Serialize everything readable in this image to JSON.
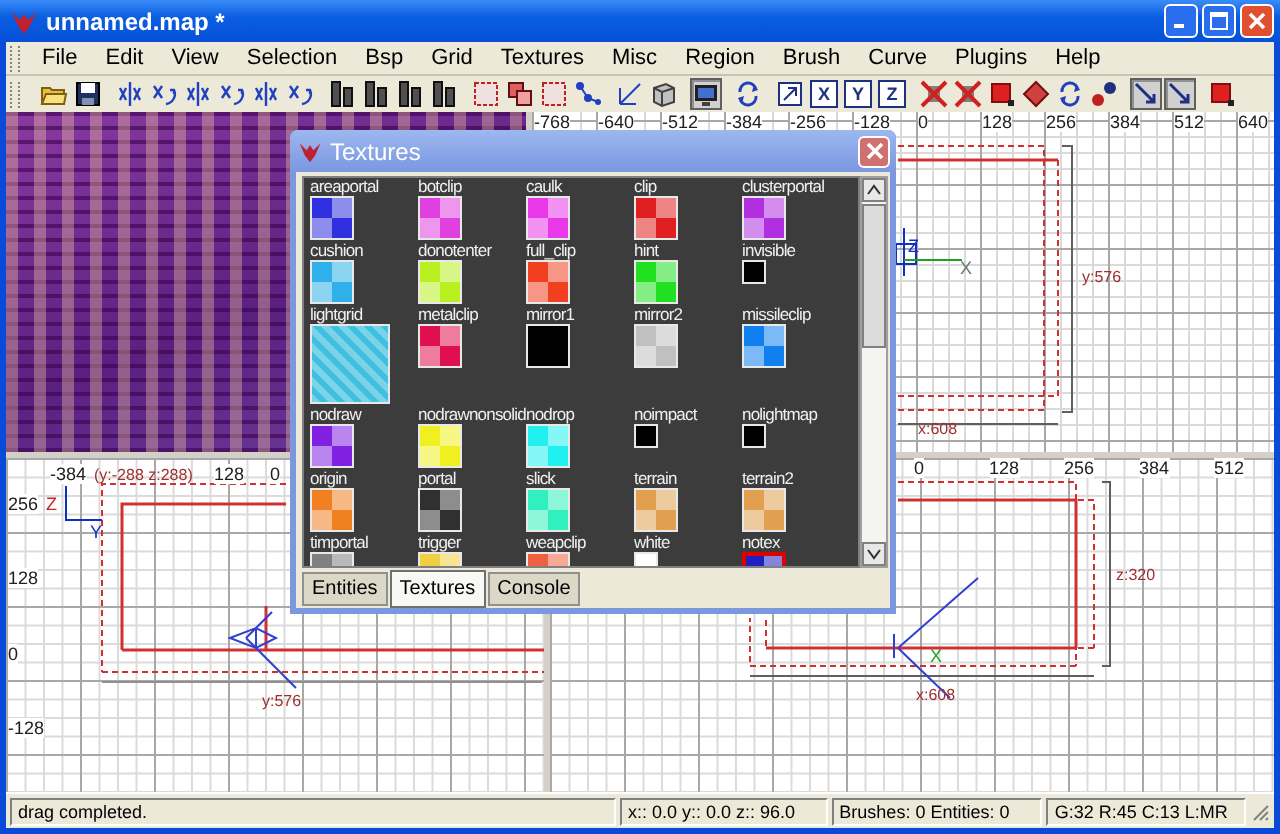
{
  "window": {
    "title": "unnamed.map *"
  },
  "menu": [
    "File",
    "Edit",
    "View",
    "Selection",
    "Bsp",
    "Grid",
    "Textures",
    "Misc",
    "Region",
    "Brush",
    "Curve",
    "Plugins",
    "Help"
  ],
  "toolbar": [
    [
      {
        "kind": "folder",
        "pressed": false
      },
      {
        "kind": "disk",
        "pressed": false
      }
    ],
    [
      {
        "kind": "flip",
        "pressed": false
      },
      {
        "kind": "rotate",
        "pressed": false
      },
      {
        "kind": "flip",
        "pressed": false
      },
      {
        "kind": "rotate",
        "pressed": false
      },
      {
        "kind": "flip",
        "pressed": false
      },
      {
        "kind": "rotate",
        "pressed": false
      }
    ],
    [
      {
        "kind": "brush",
        "pressed": false
      },
      {
        "kind": "brush",
        "pressed": false
      },
      {
        "kind": "brush",
        "pressed": false
      },
      {
        "kind": "brush",
        "pressed": false
      }
    ],
    [
      {
        "kind": "marquee",
        "pressed": false
      },
      {
        "kind": "copy",
        "pressed": false
      },
      {
        "kind": "marquee",
        "pressed": false
      },
      {
        "kind": "nodes",
        "pressed": false
      }
    ],
    [
      {
        "kind": "axes",
        "pressed": false
      },
      {
        "kind": "cube",
        "pressed": false
      }
    ],
    [
      {
        "kind": "monitor",
        "pressed": true
      }
    ],
    [
      {
        "kind": "cycle",
        "pressed": false
      }
    ],
    [
      {
        "kind": "arrow-box",
        "pressed": false
      },
      {
        "kind": "letter",
        "label": "X",
        "pressed": false
      },
      {
        "kind": "letter",
        "label": "Y",
        "pressed": false
      },
      {
        "kind": "letter",
        "label": "Z",
        "pressed": false
      }
    ],
    [
      {
        "kind": "red-cross",
        "pressed": false
      },
      {
        "kind": "red-cross",
        "pressed": false
      },
      {
        "kind": "red-square",
        "pressed": false
      },
      {
        "kind": "diamond",
        "pressed": false
      },
      {
        "kind": "cycle",
        "pressed": false
      },
      {
        "kind": "dots",
        "pressed": false
      }
    ],
    [
      {
        "kind": "diag",
        "pressed": true
      },
      {
        "kind": "diag",
        "pressed": true
      }
    ],
    [
      {
        "kind": "red-square",
        "pressed": false
      }
    ]
  ],
  "views": [
    {
      "kind": "camera"
    },
    {
      "kind": "grid",
      "top_ruler": [
        "-768",
        "-640",
        "-512",
        "-384",
        "-256",
        "-128",
        "0",
        "128",
        "256",
        "384",
        "512",
        "640"
      ],
      "annotations": [
        "y:576",
        "x:608"
      ],
      "axis_labels": [
        "Z",
        "X"
      ]
    },
    {
      "kind": "grid",
      "top_ruler": [
        "-384",
        "128",
        "0"
      ],
      "side_ruler": [
        "256",
        "128",
        "0",
        "-128"
      ],
      "annotations": [
        "(y:-288  z:288)",
        "y:576"
      ],
      "axis_labels": [
        "Z",
        "Y"
      ]
    },
    {
      "kind": "grid",
      "top_ruler": [
        "0",
        "128",
        "256",
        "384",
        "512"
      ],
      "annotations": [
        "z:320",
        "x:608"
      ],
      "axis_labels": [
        "X"
      ]
    }
  ],
  "textures_window": {
    "title": "Textures",
    "items": [
      {
        "name": "areaportal",
        "kind": "checker",
        "color": "#3030e0",
        "selected": false
      },
      {
        "name": "botclip",
        "kind": "checker",
        "color": "#e040e0",
        "selected": false
      },
      {
        "name": "caulk",
        "kind": "checker",
        "color": "#e838e8",
        "selected": false
      },
      {
        "name": "clip",
        "kind": "checker",
        "color": "#e02020",
        "selected": false
      },
      {
        "name": "clusterportal",
        "kind": "checker",
        "color": "#b030e0",
        "selected": false
      },
      {
        "name": "cushion",
        "kind": "checker",
        "color": "#30b0e8",
        "selected": false
      },
      {
        "name": "donotenter",
        "kind": "checker",
        "color": "#b8f020",
        "selected": false
      },
      {
        "name": "full_clip",
        "kind": "checker",
        "color": "#f04020",
        "selected": false
      },
      {
        "name": "hint",
        "kind": "checker",
        "color": "#20e020",
        "selected": false
      },
      {
        "name": "invisible",
        "kind": "tiny",
        "color": "#000000",
        "selected": false
      },
      {
        "name": "lightgrid",
        "kind": "large",
        "color": "#40c0e0",
        "selected": false
      },
      {
        "name": "metalclip",
        "kind": "checker",
        "color": "#e01050",
        "selected": false
      },
      {
        "name": "mirror1",
        "kind": "solid",
        "color": "#000000",
        "selected": false
      },
      {
        "name": "mirror2",
        "kind": "checker",
        "color": "#c0c0c0",
        "selected": false
      },
      {
        "name": "missileclip",
        "kind": "checker",
        "color": "#1080f0",
        "selected": false
      },
      {
        "name": "nodraw",
        "kind": "checker",
        "color": "#8020e0",
        "selected": false
      },
      {
        "name": "nodrawnonsolid",
        "kind": "checker",
        "color": "#f0f020",
        "selected": false
      },
      {
        "name": "nodrop",
        "kind": "checker",
        "color": "#20f0f0",
        "selected": false
      },
      {
        "name": "noimpact",
        "kind": "tiny",
        "color": "#000000",
        "selected": false
      },
      {
        "name": "nolightmap",
        "kind": "tiny",
        "color": "#000000",
        "selected": false
      },
      {
        "name": "origin",
        "kind": "checker",
        "color": "#f08020",
        "selected": false
      },
      {
        "name": "portal",
        "kind": "checker",
        "color": "#303030",
        "selected": false
      },
      {
        "name": "slick",
        "kind": "checker",
        "color": "#30f0c0",
        "selected": false
      },
      {
        "name": "terrain",
        "kind": "checker",
        "color": "#e0a050",
        "selected": false
      },
      {
        "name": "terrain2",
        "kind": "checker",
        "color": "#e0a050",
        "selected": false
      },
      {
        "name": "timportal",
        "kind": "checker",
        "color": "#808080",
        "selected": false
      },
      {
        "name": "trigger",
        "kind": "checker",
        "color": "#f0d040",
        "selected": false
      },
      {
        "name": "weapclip",
        "kind": "checker",
        "color": "#f06040",
        "selected": false
      },
      {
        "name": "white",
        "kind": "tiny",
        "color": "#ffffff",
        "selected": false
      },
      {
        "name": "notex",
        "kind": "checker",
        "color": "#2020c0",
        "selected": true
      }
    ],
    "tabs": [
      {
        "label": "Entities",
        "selected": false
      },
      {
        "label": "Textures",
        "selected": true
      },
      {
        "label": "Console",
        "selected": false
      }
    ]
  },
  "status_bar": [
    "drag completed.",
    "x:: 0.0  y:: 0.0  z:: 96.0",
    "Brushes: 0 Entities: 0",
    "G:32 R:45 C:13 L:MR"
  ]
}
